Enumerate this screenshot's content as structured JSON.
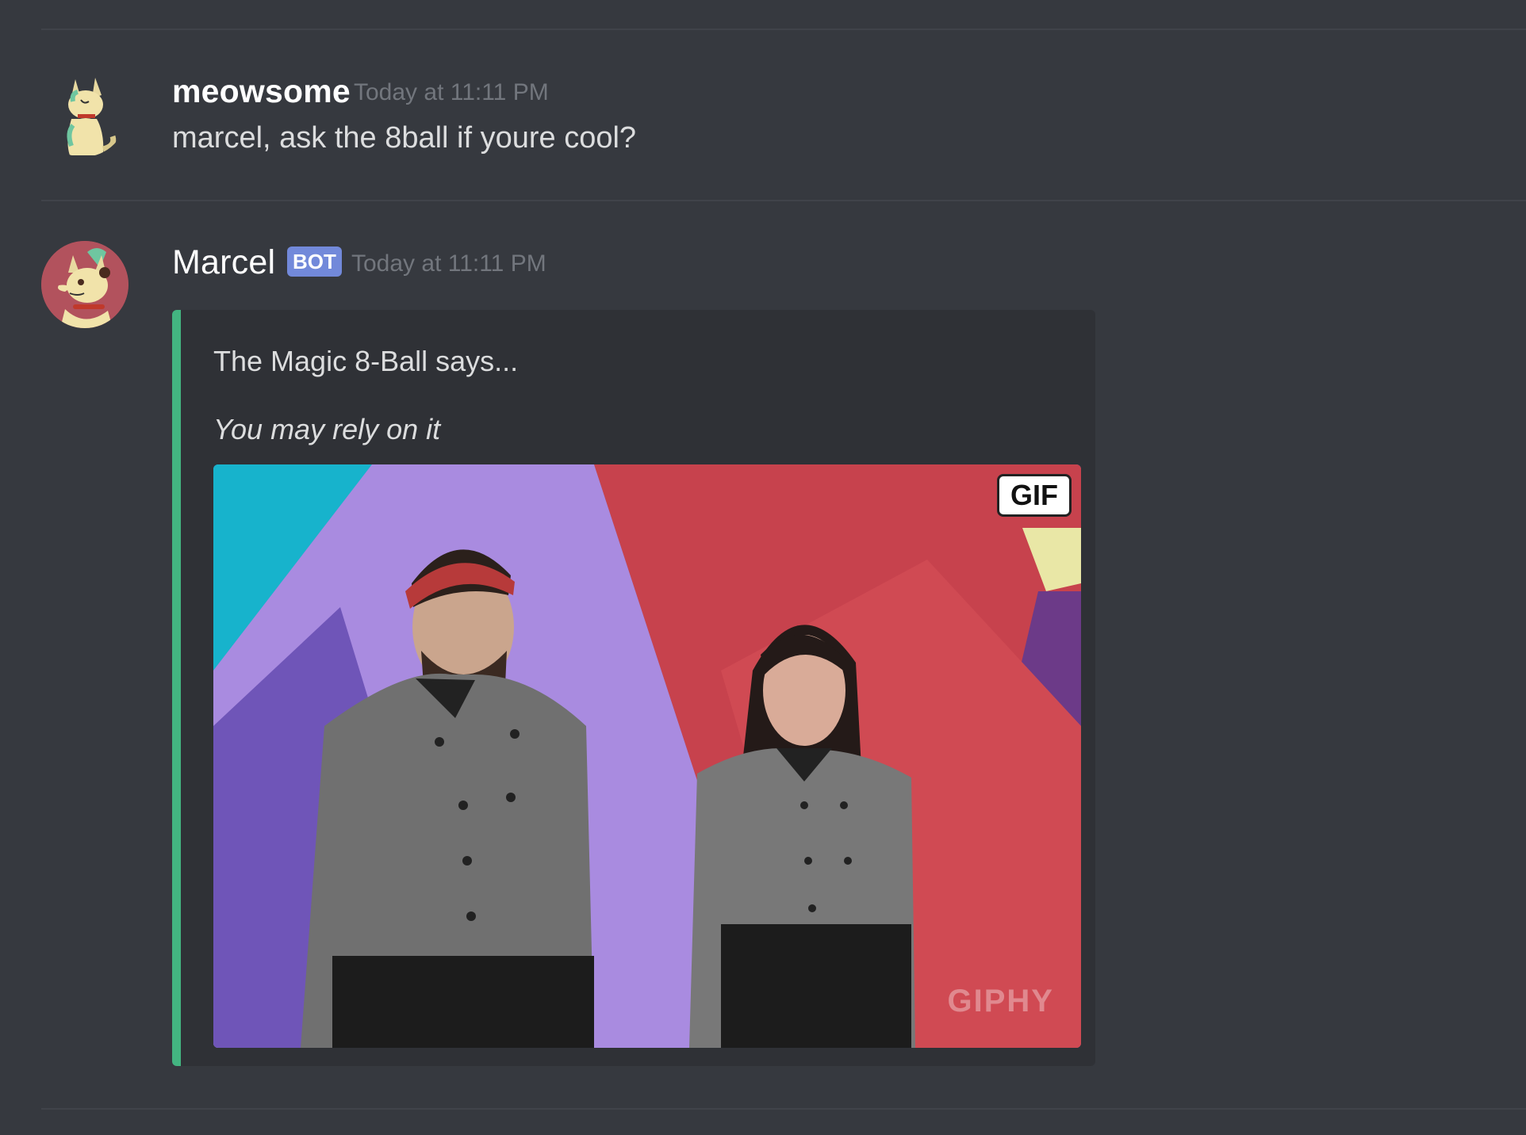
{
  "messages": [
    {
      "username": "meowsome",
      "timestamp": "Today at 11:11 PM",
      "text": "marcel, ask the 8ball if youre cool?",
      "avatar_icon": "cat-sitting-avatar"
    },
    {
      "username": "Marcel",
      "bot_tag": "BOT",
      "timestamp": "Today at 11:11 PM",
      "avatar_icon": "fox-character-avatar",
      "embed": {
        "accent_color": "#43b581",
        "title_line": "The Magic 8-Ball says...",
        "answer": "You may rely on it",
        "gif_badge": "GIF",
        "gif_watermark": "GIPHY"
      }
    }
  ],
  "colors": {
    "background": "#36393f",
    "embed_background": "#2f3136",
    "bot_tag": "#7289da",
    "timestamp": "#72767d"
  }
}
